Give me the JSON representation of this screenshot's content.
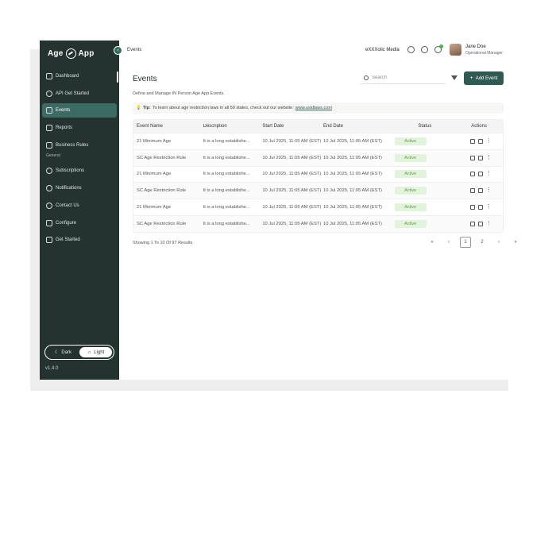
{
  "app": {
    "logo_left": "Age",
    "logo_right": "App",
    "version": "v1.4.0"
  },
  "topbar": {
    "breadcrumb": "Events",
    "org": "eXXXotic Media",
    "user_name": "Jane Doe",
    "user_role": "Operational Manager"
  },
  "sidebar": {
    "items": [
      {
        "label": "Dashboard",
        "icon": "grid-icon"
      },
      {
        "label": "API Get Started",
        "icon": "cloud-icon"
      },
      {
        "label": "Events",
        "icon": "calendar-icon",
        "active": true
      },
      {
        "label": "Reports",
        "icon": "report-icon"
      },
      {
        "label": "Business Rules",
        "icon": "list-icon"
      }
    ],
    "section_label": "General",
    "general_items": [
      {
        "label": "Subscriptions",
        "icon": "dollar-icon"
      },
      {
        "label": "Notifications",
        "icon": "bell-icon"
      },
      {
        "label": "Contact Us",
        "icon": "phone-icon"
      },
      {
        "label": "Configure",
        "icon": "sliders-icon"
      },
      {
        "label": "Get Started",
        "icon": "book-icon"
      }
    ],
    "theme": {
      "dark_label": "Dark",
      "light_label": "Light",
      "selected": "Light"
    }
  },
  "main": {
    "title": "Events",
    "subtitle": "Define and Manage IN Person Age App Events.",
    "search_placeholder": "Search",
    "add_label": "Add Event",
    "tip": {
      "prefix": "Tip:",
      "text": "To learn about age restriction laws in all 50 states, check out our website:",
      "link": "www.usidlaws.com"
    },
    "columns": [
      "Event Name",
      "Description",
      "Start Date",
      "End Date",
      "Status",
      "Actions"
    ],
    "rows": [
      {
        "name": "21 Minimum Age",
        "desc": "It is a long establishe...",
        "start": "10 Jul 2025, 11:05 AM (EST)",
        "end": "10 Jul 2025, 11:05 AM (EST)",
        "status": "Active"
      },
      {
        "name": "SC Age Restriction Rule",
        "desc": "It is a long establishe...",
        "start": "10 Jul 2025, 11:05 AM (EST)",
        "end": "10 Jul 2025, 11:05 AM (EST)",
        "status": "Active"
      },
      {
        "name": "21 Minimum Age",
        "desc": "It is a long establishe...",
        "start": "10 Jul 2025, 11:05 AM (EST)",
        "end": "10 Jul 2025, 11:05 AM (EST)",
        "status": "Active"
      },
      {
        "name": "SC Age Restriction Rule",
        "desc": "It is a long establishe...",
        "start": "10 Jul 2025, 11:05 AM (EST)",
        "end": "10 Jul 2025, 11:05 AM (EST)",
        "status": "Active"
      },
      {
        "name": "21 Minimum Age",
        "desc": "It is a long establishe...",
        "start": "10 Jul 2025, 11:05 AM (EST)",
        "end": "10 Jul 2025, 11:05 AM (EST)",
        "status": "Active"
      },
      {
        "name": "SC Age Restriction Rule",
        "desc": "It is a long establishe...",
        "start": "10 Jul 2025, 11:05 AM (EST)",
        "end": "10 Jul 2025, 11:05 AM (EST)",
        "status": "Active"
      }
    ],
    "results_text": "Showing 1 To 10 Of 97 Results",
    "pagination": {
      "first": "«",
      "prev": "‹",
      "pages": [
        "1",
        "2"
      ],
      "current": "1",
      "next": "›",
      "last": "»"
    }
  },
  "colors": {
    "sidebar_bg": "#243230",
    "accent": "#2e5a52",
    "active_item": "#3b6b63",
    "status_bg": "#e3f4dc",
    "status_text": "#5d9a46"
  }
}
